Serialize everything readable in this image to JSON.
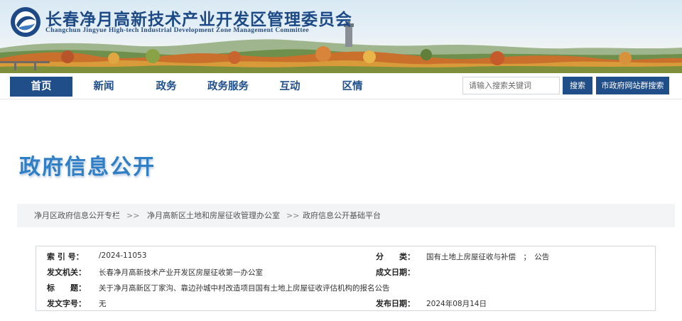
{
  "header": {
    "org_name_cn": "长春净月高新技术产业开发区管理委员会",
    "org_name_en": "Changchun Jingyue High-tech Industrial Development Zone Management Committee"
  },
  "nav": {
    "items": [
      {
        "label": "首页"
      },
      {
        "label": "新闻"
      },
      {
        "label": "政务"
      },
      {
        "label": "政务服务"
      },
      {
        "label": "互动"
      },
      {
        "label": "区情"
      }
    ],
    "search_placeholder": "请输入搜索关键词",
    "search_button": "搜索",
    "site_search_button": "市政府网站群搜索"
  },
  "page_title": "政府信息公开",
  "breadcrumb": {
    "items": [
      {
        "label": "净月区政府信息公开专栏"
      },
      {
        "label": "净月高新区土地和房屋征收管理办公室"
      },
      {
        "label": "政府信息公开基础平台"
      }
    ],
    "separator": ">>"
  },
  "info": {
    "index_label": "索 引 号：",
    "index_value": "/2024-11053",
    "category_label": "分　　类：",
    "category_value": "国有土地上房屋征收与补偿　；　公告",
    "issuer_label": "发文机关：",
    "issuer_value": "长春净月高新技术产业开发区房屋征收第一办公室",
    "written_date_label": "成文日期：",
    "written_date_value": "",
    "title_label": "标　　题：",
    "title_value": "关于净月高新区丁家沟、靠边孙城中村改造项目国有土地上房屋征收评估机构的报名公告",
    "doc_number_label": "发文字号：",
    "doc_number_value": "无",
    "publish_date_label": "发布日期：",
    "publish_date_value": "2024年08月14日"
  },
  "colors": {
    "brand_blue": "#1f4e88",
    "title_blue": "#2e7fc6"
  }
}
